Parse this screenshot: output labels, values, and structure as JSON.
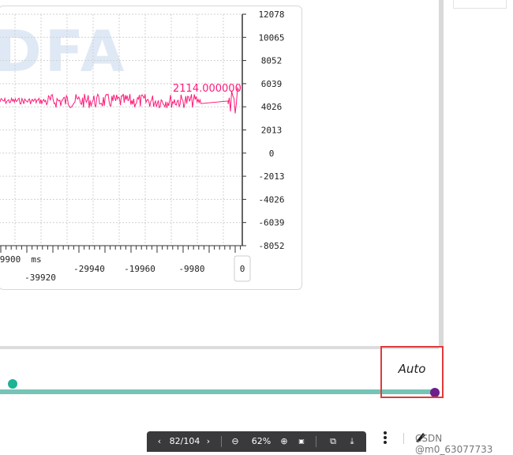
{
  "chart": {
    "y_ticks": [
      "12078",
      "10065",
      "8052",
      "6039",
      "4026",
      "2013",
      "0",
      "-2013",
      "-4026",
      "-6039",
      "-8052"
    ],
    "x_ticks_top": [
      "9900",
      "ms"
    ],
    "x_ticks_bottom": [
      "-39920",
      "-29940",
      "-19960",
      "-9980",
      "0"
    ],
    "value_label": "2114.000000",
    "watermark": "DFA",
    "signal_color": "#ff1a7a"
  },
  "timeline": {
    "mode_label": "Auto",
    "track_color": "#76c4b5",
    "start_marker_color": "#1db394",
    "end_marker_color": "#6b1f8a",
    "highlight_color": "#e03a3a"
  },
  "viewer": {
    "page_indicator": "82/104",
    "zoom_level": "62%",
    "prev_icon": "chevron-left-icon",
    "next_icon": "chevron-right-icon",
    "zoom_out_icon": "zoom-out-icon",
    "zoom_in_icon": "zoom-in-icon",
    "fit_icon": "fit-page-icon",
    "rotate_icon": "rotate-icon",
    "download_icon": "download-icon"
  },
  "footer": {
    "watermark_text": "CSDN @m0_63077733"
  }
}
